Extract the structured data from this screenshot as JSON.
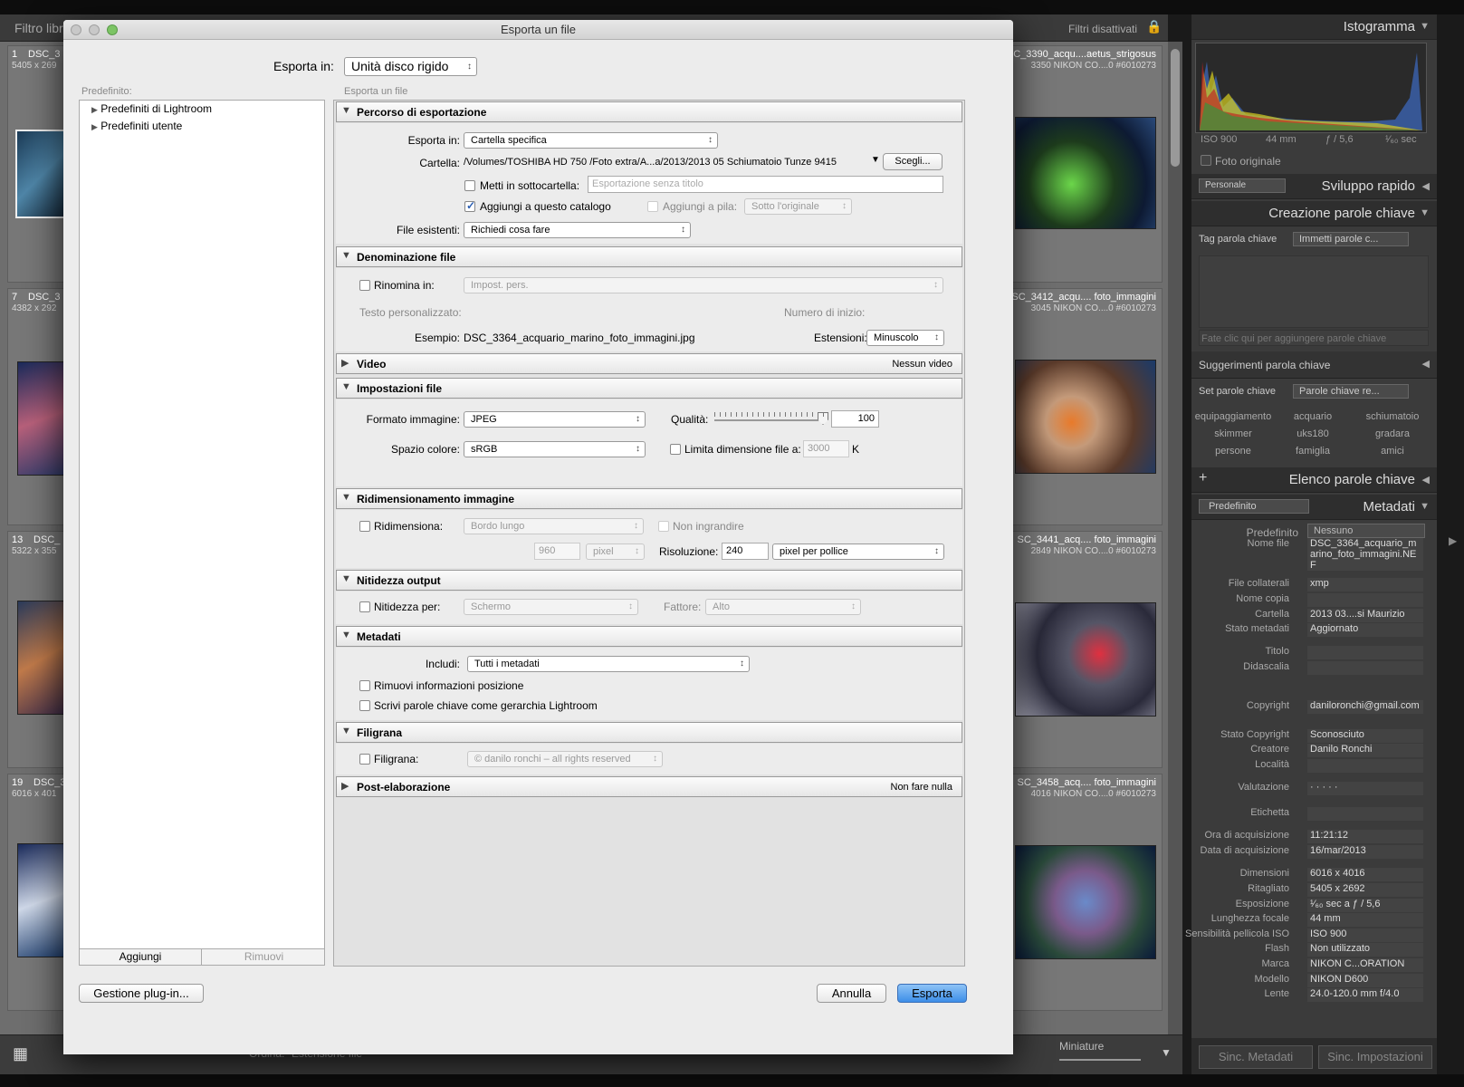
{
  "background": {
    "filter_label": "Filtro libr",
    "filters_off": "Filtri disattivati",
    "cells": [
      {
        "num": "1",
        "name": "DSC_3",
        "dim": "5405 x 269",
        "right_name": "SC_3390_acqu....aetus_strigosus",
        "right_sub": "3350     NIKON CO....0 #6010273"
      },
      {
        "num": "7",
        "name": "DSC_3",
        "dim": "4382 x 292",
        "right_name": "SC_3412_acqu.... foto_immagini",
        "right_sub": "3045     NIKON CO....0 #6010273"
      },
      {
        "num": "13",
        "name": "DSC_",
        "dim": "5322 x 355",
        "right_name": "SC_3441_acq.... foto_immagini",
        "right_sub": "2849     NIKON CO....0 #6010273"
      },
      {
        "num": "19",
        "name": "DSC_3",
        "dim": "6016 x 401",
        "right_name": "SC_3458_acq.... foto_immagini",
        "right_sub": "4016     NIKON CO....0 #6010273"
      }
    ],
    "sort_label": "Ordina:",
    "sort_value": "Estensione file",
    "thumbs_label": "Miniature"
  },
  "right_panel": {
    "histogram_title": "Istogramma",
    "iso": "ISO 900",
    "focal": "44 mm",
    "aperture": "ƒ / 5,6",
    "shutter": "¹⁄₆₀ sec",
    "original_photo": "Foto originale",
    "preset_select": "Personale",
    "quick_develop": "Sviluppo rapido",
    "keywording": "Creazione parole chiave",
    "tag_label": "Tag parola chiave",
    "tag_select": "Immetti parole c...",
    "add_keywords_hint": "Fate clic qui per aggiungere parole chiave",
    "suggestions": "Suggerimenti parola chiave",
    "set_label": "Set parole chiave",
    "set_select": "Parole chiave re...",
    "keywords": [
      "equipaggiamento",
      "acquario",
      "schiumatoio",
      "skimmer",
      "uks180",
      "gradara",
      "persone",
      "famiglia",
      "amici"
    ],
    "keyword_list": "Elenco parole chiave",
    "metadata_preset_select": "Predefinito",
    "metadata_title": "Metadati",
    "metadata": {
      "preset_label": "Predefinito",
      "preset_value": "Nessuno",
      "rows": [
        {
          "label": "Nome file",
          "value": "DSC_3364_acquario_marino_foto_immagini.NEF"
        },
        {
          "label": "File collaterali",
          "value": "xmp"
        },
        {
          "label": "Nome copia",
          "value": ""
        },
        {
          "label": "Cartella",
          "value": "2013 03....si Maurizio"
        },
        {
          "label": "Stato metadati",
          "value": "Aggiornato"
        },
        {
          "label": "Titolo",
          "value": ""
        },
        {
          "label": "Didascalia",
          "value": ""
        },
        {
          "label": "Copyright",
          "value": "daniloronchi@gmail.com"
        },
        {
          "label": "Stato Copyright",
          "value": "Sconosciuto"
        },
        {
          "label": "Creatore",
          "value": "Danilo Ronchi"
        },
        {
          "label": "Località",
          "value": ""
        },
        {
          "label": "Valutazione",
          "value": "· · · · ·"
        },
        {
          "label": "Etichetta",
          "value": ""
        },
        {
          "label": "Ora di acquisizione",
          "value": "11:21:12"
        },
        {
          "label": "Data di acquisizione",
          "value": "16/mar/2013"
        },
        {
          "label": "Dimensioni",
          "value": "6016 x 4016"
        },
        {
          "label": "Ritagliato",
          "value": "5405 x 2692"
        },
        {
          "label": "Esposizione",
          "value": "¹⁄₆₀ sec a ƒ / 5,6"
        },
        {
          "label": "Lunghezza focale",
          "value": "44 mm"
        },
        {
          "label": "Sensibilità pellicola ISO",
          "value": "ISO 900"
        },
        {
          "label": "Flash",
          "value": "Non utilizzato"
        },
        {
          "label": "Marca",
          "value": "NIKON C...ORATION"
        },
        {
          "label": "Modello",
          "value": "NIKON D600"
        },
        {
          "label": "Lente",
          "value": "24.0-120.0 mm f/4.0"
        }
      ]
    },
    "sync_metadata": "Sinc. Metadati",
    "sync_settings": "Sinc. Impostazioni"
  },
  "dialog": {
    "title": "Esporta un file",
    "export_to_label": "Esporta in:",
    "export_to_value": "Unità disco rigido",
    "presets_label": "Predefinito:",
    "content_label": "Esporta un file",
    "presets": [
      "Predefiniti di Lightroom",
      "Predefiniti utente"
    ],
    "add_button": "Aggiungi",
    "remove_button": "Rimuovi",
    "plugin_button": "Gestione plug-in...",
    "cancel_button": "Annulla",
    "export_button": "Esporta",
    "location": {
      "title": "Percorso di esportazione",
      "export_to_label": "Esporta in:",
      "export_to_value": "Cartella specifica",
      "folder_label": "Cartella:",
      "folder_value": "/Volumes/TOSHIBA HD 750 /Foto extra/A...a/2013/2013 05 Schiumatoio Tunze 9415",
      "choose_button": "Scegli...",
      "subfolder_label": "Metti in sottocartella:",
      "subfolder_placeholder": "Esportazione senza titolo",
      "add_catalog_label": "Aggiungi a questo catalogo",
      "add_stack_label": "Aggiungi a pila:",
      "stack_value": "Sotto l'originale",
      "existing_label": "File esistenti:",
      "existing_value": "Richiedi cosa fare"
    },
    "naming": {
      "title": "Denominazione file",
      "rename_label": "Rinomina in:",
      "rename_value": "Impost. pers.",
      "custom_text_label": "Testo personalizzato:",
      "start_number_label": "Numero di inizio:",
      "example_label": "Esempio:",
      "example_value": "DSC_3364_acquario_marino_foto_immagini.jpg",
      "extensions_label": "Estensioni:",
      "extensions_value": "Minuscolo"
    },
    "video": {
      "title": "Video",
      "summary": "Nessun video"
    },
    "file_settings": {
      "title": "Impostazioni file",
      "format_label": "Formato immagine:",
      "format_value": "JPEG",
      "quality_label": "Qualità:",
      "quality_value": "100",
      "quality_fraction": 1.0,
      "colorspace_label": "Spazio colore:",
      "colorspace_value": "sRGB",
      "limit_label": "Limita dimensione file a:",
      "limit_value": "3000",
      "limit_unit": "K"
    },
    "resize": {
      "title": "Ridimensionamento immagine",
      "resize_label": "Ridimensiona:",
      "resize_value": "Bordo lungo",
      "no_enlarge_label": "Non ingrandire",
      "size_value": "960",
      "size_unit": "pixel",
      "resolution_label": "Risoluzione:",
      "resolution_value": "240",
      "resolution_unit": "pixel per pollice"
    },
    "sharpening": {
      "title": "Nitidezza output",
      "sharpen_label": "Nitidezza per:",
      "sharpen_value": "Schermo",
      "amount_label": "Fattore:",
      "amount_value": "Alto"
    },
    "metadata": {
      "title": "Metadati",
      "include_label": "Includi:",
      "include_value": "Tutti i metadati",
      "remove_location_label": "Rimuovi informazioni posizione",
      "write_keywords_label": "Scrivi parole chiave come gerarchia Lightroom"
    },
    "watermark": {
      "title": "Filigrana",
      "watermark_label": "Filigrana:",
      "watermark_value": "© danilo ronchi – all rights reserved"
    },
    "post": {
      "title": "Post-elaborazione",
      "summary": "Non fare nulla"
    }
  }
}
